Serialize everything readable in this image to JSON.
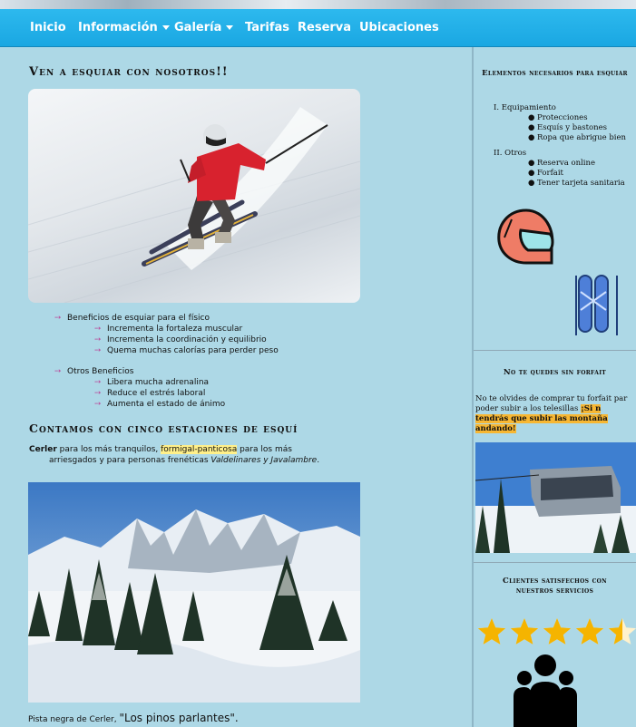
{
  "nav": {
    "items": [
      {
        "label": "Inicio",
        "dropdown": false
      },
      {
        "label": "Información",
        "dropdown": true
      },
      {
        "label": "Galería",
        "dropdown": true
      },
      {
        "label": "Tarifas",
        "dropdown": false
      },
      {
        "label": "Reserva",
        "dropdown": false
      },
      {
        "label": "Ubicaciones",
        "dropdown": false
      }
    ]
  },
  "main": {
    "title1": "Ven a esquiar con nosotros!!",
    "list_a": {
      "label": "Beneficios de esquiar para el físico",
      "items": [
        "Incrementa la fortaleza muscular",
        "Incrementa la coordinación y equilibrio",
        "Quema muchas calorías para perder peso"
      ]
    },
    "list_b": {
      "label": "Otros Beneficios",
      "items": [
        "Libera mucha adrenalina",
        "Reduce el estrés laboral",
        "Aumenta el estado de ánimo"
      ]
    },
    "title2": "Contamos con cinco estaciones de esquí",
    "para": {
      "strong": "Cerler",
      "text1": " para los más tranquilos, ",
      "highlight": "formigal-panticosa",
      "text2": " para los más",
      "line2": "arriesgados y para personas frenéticas ",
      "italic": "Valdelinares y Javalambre",
      "end": "."
    },
    "caption_prefix": "Pista negra de Cerler,",
    "caption_quote": "\"Los pinos parlantes\"."
  },
  "sidebar": {
    "section1": {
      "title": "Elementos necesarios para esquiar",
      "groups": [
        {
          "numeral": "I.",
          "label": "Equipamiento",
          "items": [
            "Protecciones",
            "Esquís y bastones",
            "Ropa que abrigue bien"
          ]
        },
        {
          "numeral": "II.",
          "label": "Otros",
          "items": [
            "Reserva online",
            "Forfait",
            "Tener tarjeta sanitaria"
          ]
        }
      ]
    },
    "section2": {
      "title": "No te quedes sin forfait",
      "line1": "No te olvides de comprar tu forfait par",
      "line2a": "poder subir a los telesillas ",
      "line2b": "¡Si n",
      "line3": "tendrás que subir las montaña",
      "line4": "andando!"
    },
    "section3": {
      "title": "Clientes satisfechos con nuestros servicios",
      "rating": 4.5
    }
  },
  "colors": {
    "nav": "#1aa7e2",
    "background": "#add8e6",
    "highlight_yellow": "#fff08a",
    "highlight_orange": "#f7b733",
    "bullet": "#b85aa3"
  }
}
